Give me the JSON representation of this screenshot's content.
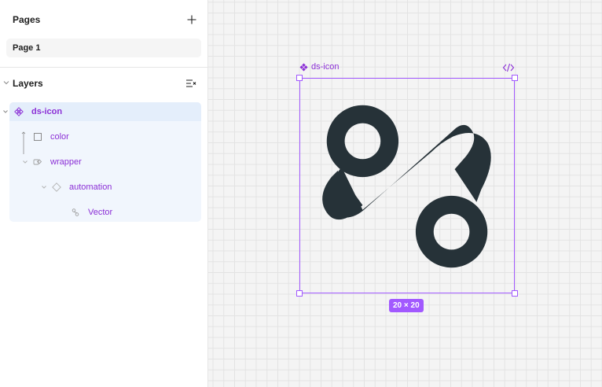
{
  "sidebar": {
    "pages": {
      "title": "Pages",
      "items": [
        {
          "label": "Page 1",
          "selected": true
        }
      ]
    },
    "layers": {
      "title": "Layers",
      "tree": [
        {
          "label": "ds-icon",
          "type": "component",
          "icon": "component-icon",
          "level": 0,
          "selected": true
        },
        {
          "label": "color",
          "type": "rectangle",
          "icon": "rectangle-icon",
          "level": 1
        },
        {
          "label": "wrapper",
          "type": "instance",
          "icon": "instance-icon",
          "level": 1,
          "expanded": true
        },
        {
          "label": "automation",
          "type": "component-instance",
          "icon": "diamond-icon",
          "level": 2,
          "expanded": true
        },
        {
          "label": "Vector",
          "type": "vector",
          "icon": "vector-icon",
          "level": 3
        }
      ]
    }
  },
  "canvas": {
    "frame_name": "ds-icon",
    "size_label": "20 × 20",
    "icon_color": "#263238",
    "selection_color": "#a259ff"
  },
  "colors": {
    "accent": "#8b2fd6",
    "selection": "#a259ff",
    "layer_highlight": "#f1f6fd"
  }
}
